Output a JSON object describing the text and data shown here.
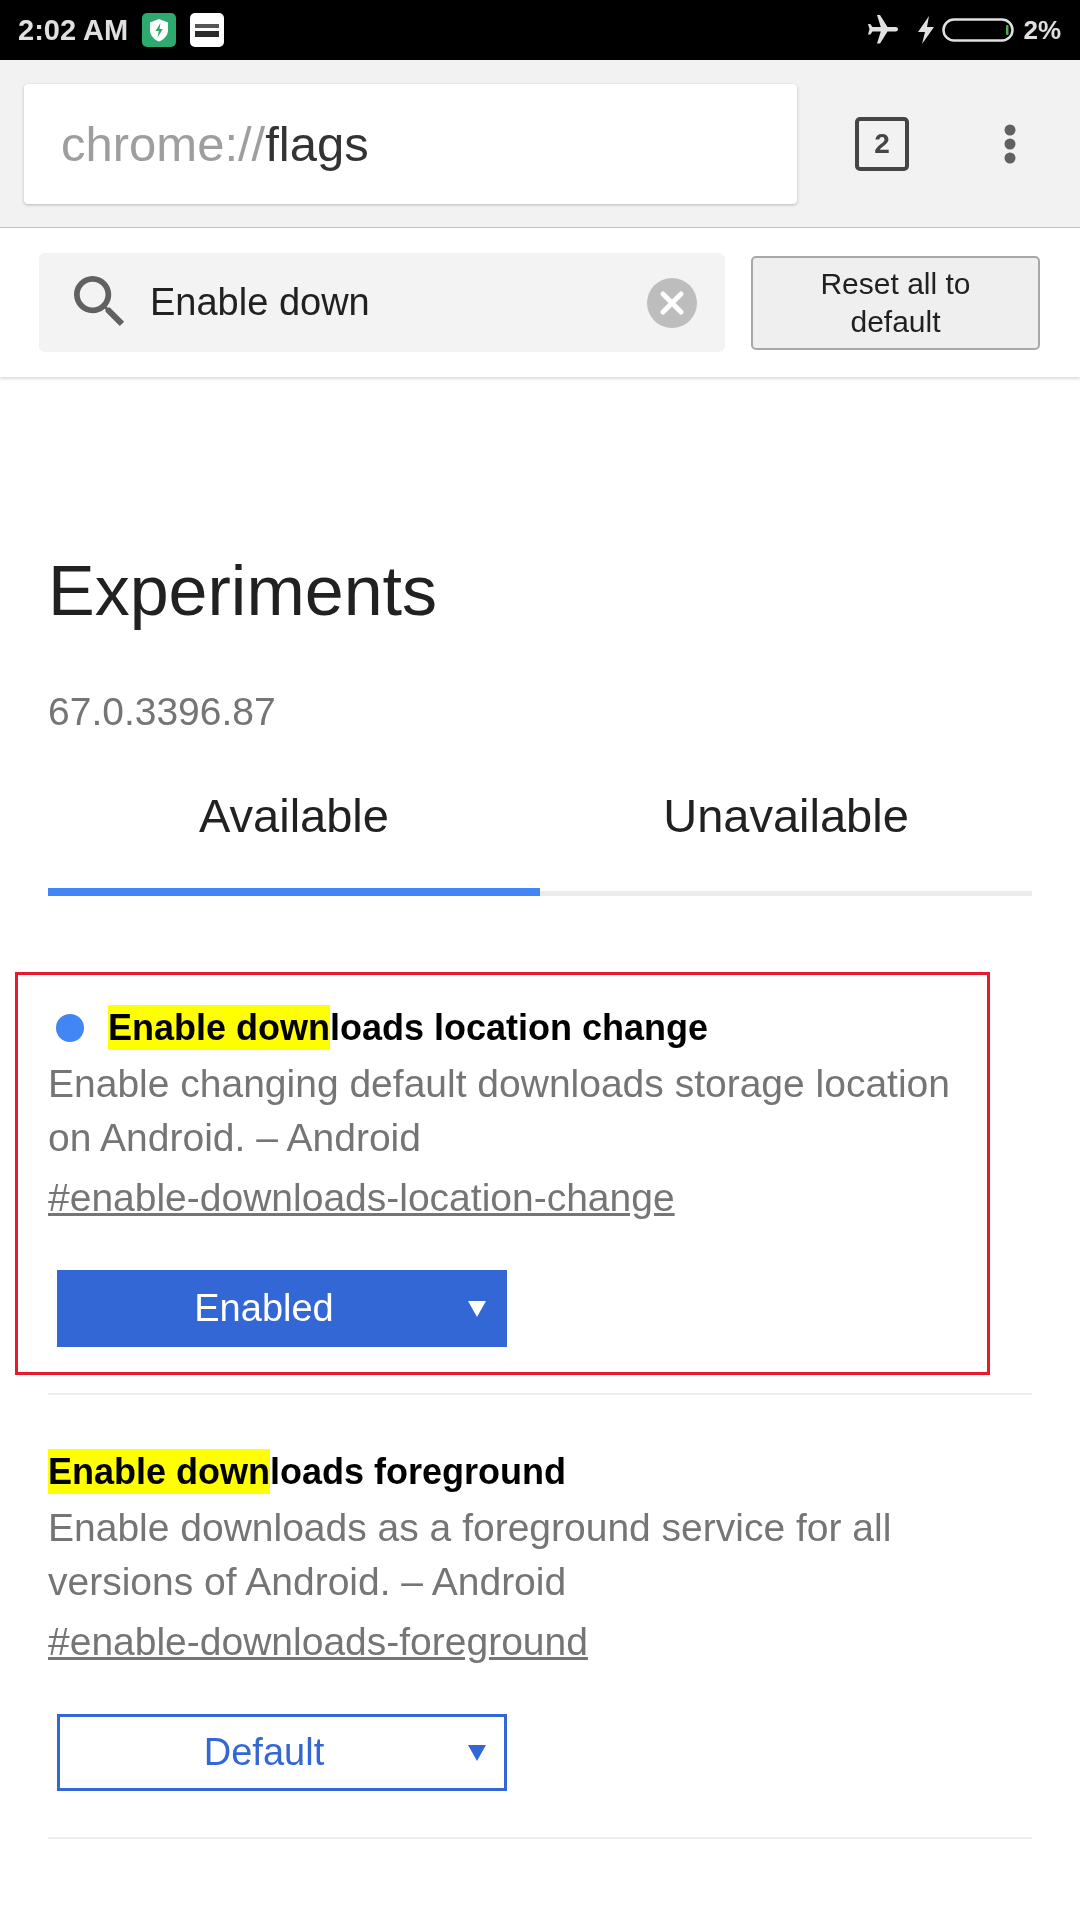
{
  "status_bar": {
    "time": "2:02 AM",
    "battery": "2%"
  },
  "toolbar": {
    "url": {
      "scheme": "chrome://",
      "host": "flags"
    },
    "tab_count": "2"
  },
  "search": {
    "value": "Enable down",
    "reset_button": "Reset all to default"
  },
  "page": {
    "title": "Experiments",
    "version": "67.0.3396.87"
  },
  "tabs": [
    {
      "label": "Available",
      "selected": true
    },
    {
      "label": "Unavailable",
      "selected": false
    }
  ],
  "experiments": [
    {
      "framed": true,
      "modified": true,
      "title_match": "Enable down",
      "title_rest": "loads location change",
      "description": "Enable changing default downloads storage location on Android. – Android",
      "link": "#enable-downloads-location-change",
      "value": "Enabled"
    },
    {
      "framed": false,
      "modified": false,
      "title_match": "Enable down",
      "title_rest": "loads foreground",
      "description": "Enable downloads as a foreground service for all versions of Android. – Android",
      "link": "#enable-downloads-foreground",
      "value": "Default"
    }
  ]
}
